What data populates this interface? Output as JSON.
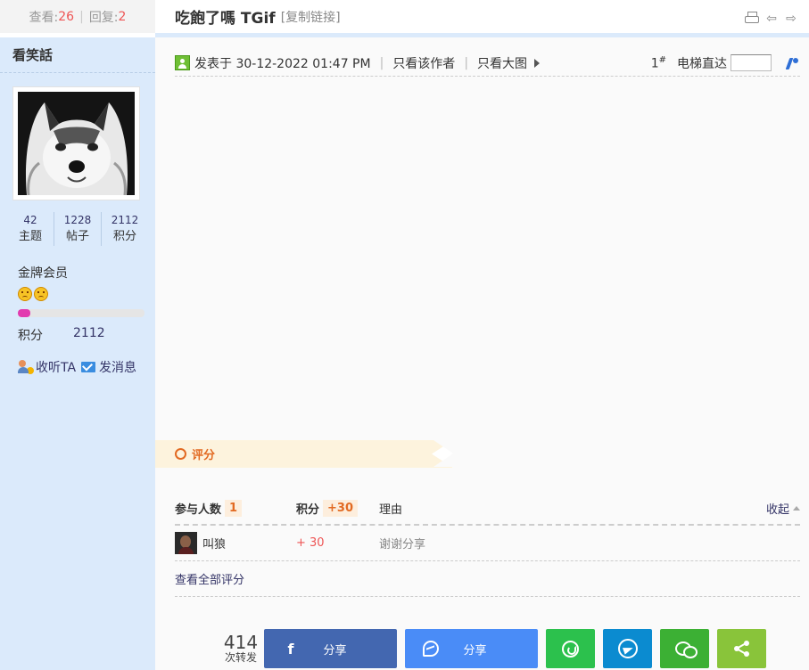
{
  "sidebar": {
    "views_label": "查看:",
    "views": "26",
    "sep": "|",
    "replies_label": "回复:",
    "replies": "2",
    "username": "看笑話",
    "stats": [
      {
        "value": "42",
        "label": "主题"
      },
      {
        "value": "1228",
        "label": "帖子"
      },
      {
        "value": "2112",
        "label": "积分"
      }
    ],
    "rank": "金牌会员",
    "progress_fraction": 0.1,
    "score_label": "积分",
    "score_value": "2112",
    "follow": "收听TA",
    "message": "发消息"
  },
  "header": {
    "title": "吃飽了嗎 TGif",
    "copy_link": "[复制链接]"
  },
  "post": {
    "posted": "发表于 30-12-2022 01:47 PM",
    "sep": "|",
    "only_author": "只看该作者",
    "only_images": "只看大图",
    "floor": "1",
    "floor_mark": "#",
    "jump_label": "电梯直达"
  },
  "rating": {
    "tab": "评分",
    "participants_label": "参与人数",
    "participants": "1",
    "points_label": "积分",
    "points": "+30",
    "reason_label": "理由",
    "collapse": "收起",
    "rows": [
      {
        "user": "叫狼",
        "points": "+ 30",
        "reason": "谢谢分享"
      }
    ],
    "view_all": "查看全部评分"
  },
  "share": {
    "count": "414",
    "count_label": "次转发",
    "facebook": "分享",
    "messenger": "分享"
  },
  "colors": {
    "sidebar_bg": "#dbeafb",
    "accent_red": "#e55555",
    "rate_orange": "#e26a22",
    "facebook": "#4367b0",
    "messenger": "#4a8cf7",
    "whatsapp": "#2cc14d",
    "telegram": "#0b8bd0",
    "wechat": "#3cb034",
    "share": "#89c43a"
  }
}
